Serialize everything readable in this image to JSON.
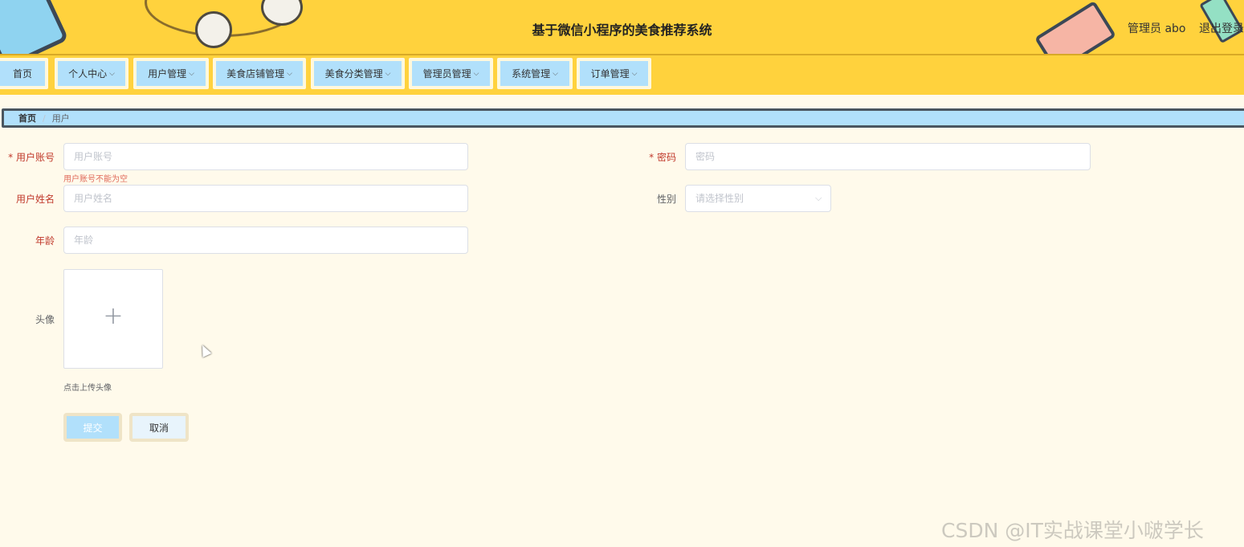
{
  "header": {
    "title": "基于微信小程序的美食推荐系统",
    "admin_label": "管理员 abo",
    "logout_label": "退出登录"
  },
  "nav": {
    "items": [
      {
        "label": "首页"
      },
      {
        "label": "个人中心"
      },
      {
        "label": "用户管理"
      },
      {
        "label": "美食店铺管理"
      },
      {
        "label": "美食分类管理"
      },
      {
        "label": "管理员管理"
      },
      {
        "label": "系统管理"
      },
      {
        "label": "订单管理"
      }
    ],
    "dropdown_glyph": "⌵"
  },
  "breadcrumb": {
    "home": "首页",
    "separator": "/",
    "current": "用户"
  },
  "form": {
    "account": {
      "label": "* 用户账号",
      "placeholder": "用户账号",
      "error": "用户账号不能为空"
    },
    "password": {
      "label": "* 密码",
      "placeholder": "密码"
    },
    "name": {
      "label": "用户姓名",
      "placeholder": "用户姓名"
    },
    "gender": {
      "label": "性别",
      "placeholder": "请选择性别"
    },
    "age": {
      "label": "年龄",
      "placeholder": "年龄"
    },
    "avatar": {
      "label": "头像",
      "hint": "点击上传头像",
      "plus": "+"
    },
    "submit_label": "提交",
    "cancel_label": "取消"
  },
  "watermark": "CSDN @IT实战课堂小啵学长",
  "colors": {
    "header_bg": "#ffd23d",
    "nav_item_bg": "#b1e0fb",
    "page_bg": "#fffaeb",
    "required_label": "#c0392b"
  }
}
